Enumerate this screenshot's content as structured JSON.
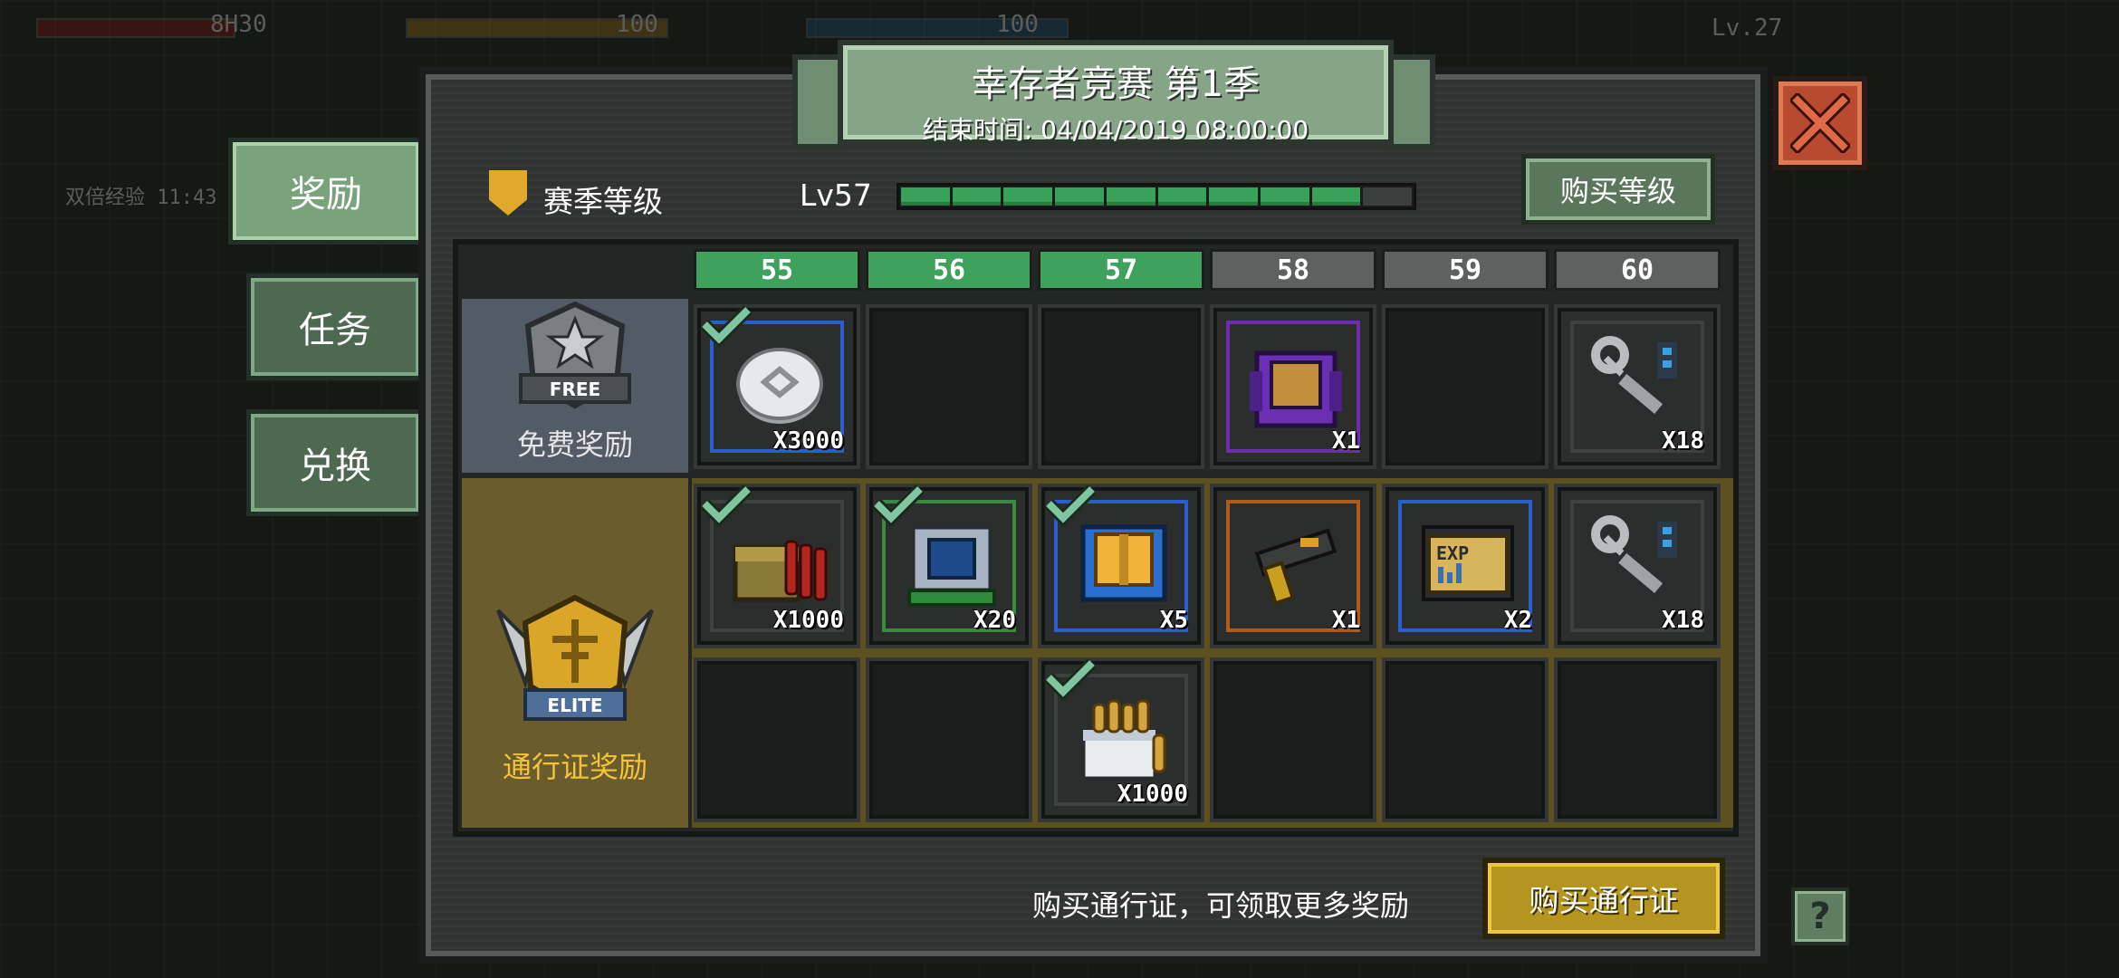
{
  "hud": {
    "hp_text": "8H30",
    "stat_a": "100",
    "stat_b": "100",
    "level": "Lv.27",
    "bonus_text": "双倍经验 11:43"
  },
  "tabs": [
    {
      "label": "奖励",
      "active": true
    },
    {
      "label": "任务",
      "active": false
    },
    {
      "label": "兑换",
      "active": false
    }
  ],
  "header": {
    "title": "幸存者竞赛 第1季",
    "end_time": "结束时间: 04/04/2019 08:00:00"
  },
  "season": {
    "label": "赛季等级",
    "level_text": "Lv57",
    "progress_segments_total": 10,
    "progress_segments_filled": 9,
    "buy_level_label": "购买等级"
  },
  "columns": [
    "55",
    "56",
    "57",
    "58",
    "59",
    "60"
  ],
  "columns_completed": 3,
  "rows": {
    "free": {
      "label": "免费奖励",
      "badge": "FREE"
    },
    "elite": {
      "label": "通行证奖励",
      "badge": "ELITE"
    }
  },
  "rewards": {
    "free": [
      {
        "icon": "silver-coin-icon",
        "qty": "X3000",
        "claimed": true,
        "rarity": "blue"
      },
      null,
      null,
      {
        "icon": "purple-crate-icon",
        "qty": "X1",
        "claimed": false,
        "rarity": "purple"
      },
      null,
      {
        "icon": "wrench-icon",
        "qty": "X18",
        "claimed": false,
        "rarity": "gray"
      }
    ],
    "elite_a": [
      {
        "icon": "ammo-box-icon",
        "qty": "X1000",
        "claimed": true,
        "rarity": "gray"
      },
      {
        "icon": "chip-crate-icon",
        "qty": "X20",
        "claimed": true,
        "rarity": "green"
      },
      {
        "icon": "blue-crate-icon",
        "qty": "X5",
        "claimed": true,
        "rarity": "blue"
      },
      {
        "icon": "pistol-icon",
        "qty": "X1",
        "claimed": false,
        "rarity": "orange"
      },
      {
        "icon": "exp-card-icon",
        "qty": "X2",
        "claimed": false,
        "rarity": "blue"
      },
      {
        "icon": "wrench-icon",
        "qty": "X18",
        "claimed": false,
        "rarity": "gray"
      }
    ],
    "elite_b": [
      null,
      null,
      {
        "icon": "bullet-box-icon",
        "qty": "X1000",
        "claimed": true,
        "rarity": "gray"
      },
      null,
      null,
      null
    ]
  },
  "rarity_colors": {
    "blue": "#2a5fd0",
    "purple": "#6b2fb0",
    "green": "#3a8a3f",
    "orange": "#b05a1c",
    "gray": "#3d4140"
  },
  "footer": {
    "note": "购买通行证，可领取更多奖励",
    "buy_pass_label": "购买通行证",
    "help_label": "?"
  }
}
